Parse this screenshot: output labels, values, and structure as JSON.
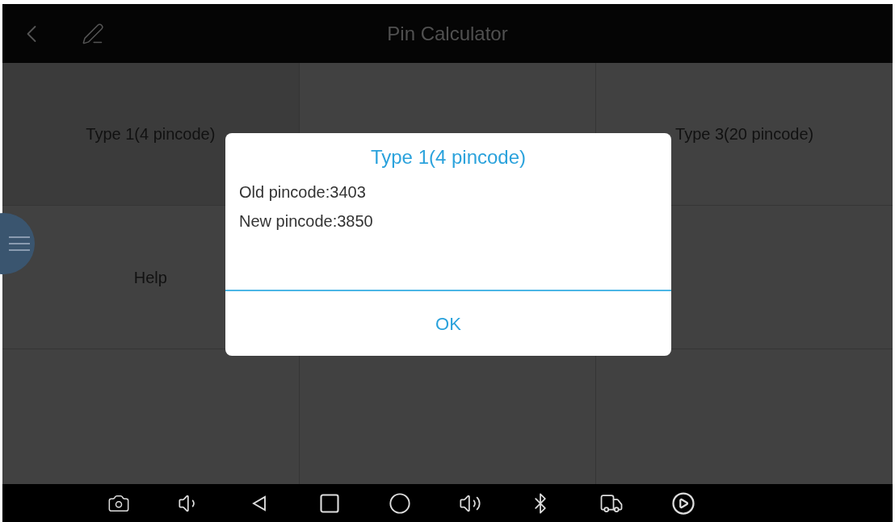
{
  "header": {
    "title": "Pin Calculator"
  },
  "tiles": {
    "top_left": "Type 1(4 pincode)",
    "top_right": "Type 3(20 pincode)",
    "middle_left": "Help"
  },
  "dialog": {
    "title": "Type 1(4 pincode)",
    "lines": [
      "Old pincode:3403",
      "New pincode:3850"
    ],
    "button": "OK"
  }
}
